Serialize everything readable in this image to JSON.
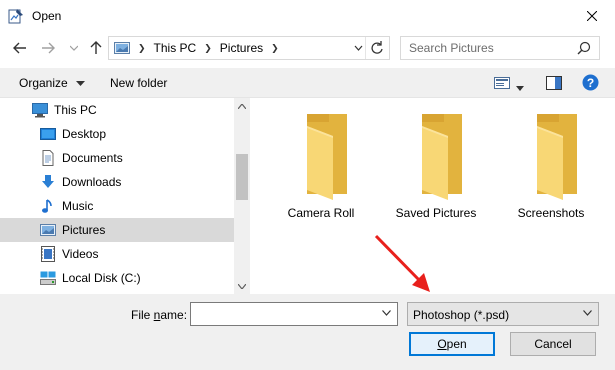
{
  "window": {
    "title": "Open"
  },
  "address": {
    "crumbs": [
      "This PC",
      "Pictures"
    ],
    "search_placeholder": "Search Pictures"
  },
  "toolbar": {
    "organize_label": "Organize",
    "new_folder_label": "New folder"
  },
  "nav": {
    "items": [
      {
        "label": "This PC",
        "icon": "computer-icon"
      },
      {
        "label": "Desktop",
        "icon": "desktop-icon"
      },
      {
        "label": "Documents",
        "icon": "documents-icon"
      },
      {
        "label": "Downloads",
        "icon": "downloads-icon"
      },
      {
        "label": "Music",
        "icon": "music-icon"
      },
      {
        "label": "Pictures",
        "icon": "pictures-icon",
        "selected": true
      },
      {
        "label": "Videos",
        "icon": "videos-icon"
      },
      {
        "label": "Local Disk (C:)",
        "icon": "local-disk-icon"
      }
    ]
  },
  "folders": [
    {
      "label": "Camera Roll"
    },
    {
      "label": "Saved Pictures"
    },
    {
      "label": "Screenshots"
    }
  ],
  "bottom": {
    "file_name_label_pre": "File ",
    "file_name_label_key": "n",
    "file_name_label_post": "ame:",
    "file_name_value": "",
    "file_type_value": "Photoshop (*.psd)",
    "open_key": "O",
    "open_rest": "pen",
    "cancel_label": "Cancel"
  },
  "colors": {
    "accent": "#0078d7",
    "annotation_arrow": "#e8201c",
    "folder_front": "#f8d775",
    "folder_back": "#e2b33e",
    "selection": "#d9d9d9"
  }
}
